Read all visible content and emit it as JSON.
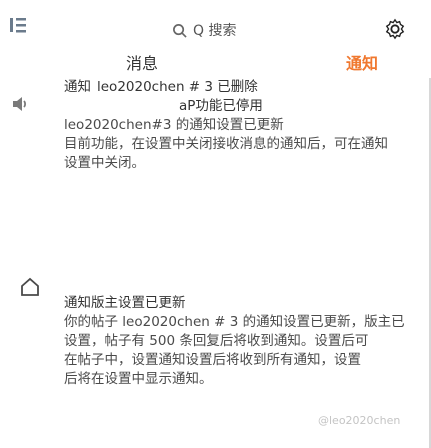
{
  "header": {
    "search_label": "Q 搜索",
    "search_icon": "search-icon",
    "settings_icon": "gear-icon"
  },
  "tabs": {
    "notifications_label": "消息",
    "mentions_label": "通知",
    "active_color": "#f0782f",
    "underline_color": "#2b6fd6"
  },
  "sidebar": {
    "icons": [
      "menu-icon",
      "speaker-icon",
      "home-icon"
    ]
  },
  "notices": [
    {
      "tag": "通知",
      "title": "leo2020chen # 3 已删除",
      "subtitle": "aP功能已停用",
      "body_lines": [
        "leo2020chen#3 的通知设置已更新",
        "目前功能，在设置中关闭接收消息的通知后，可在通知",
        "设置中关闭。"
      ]
    },
    {
      "tag": "通知版主设置已更新",
      "title": "",
      "subtitle": "",
      "body_lines": [
        "你的帖子 leo2020chen # 3 的通知设置已更新，版主已",
        "设置，帖子有 500 条回复后将收到通知。设置后可",
        "在帖子中，设置通知设置后将收到所有通知，设置",
        "后将在设置中显示通知。"
      ]
    }
  ],
  "watermark": "@leo2020chen"
}
